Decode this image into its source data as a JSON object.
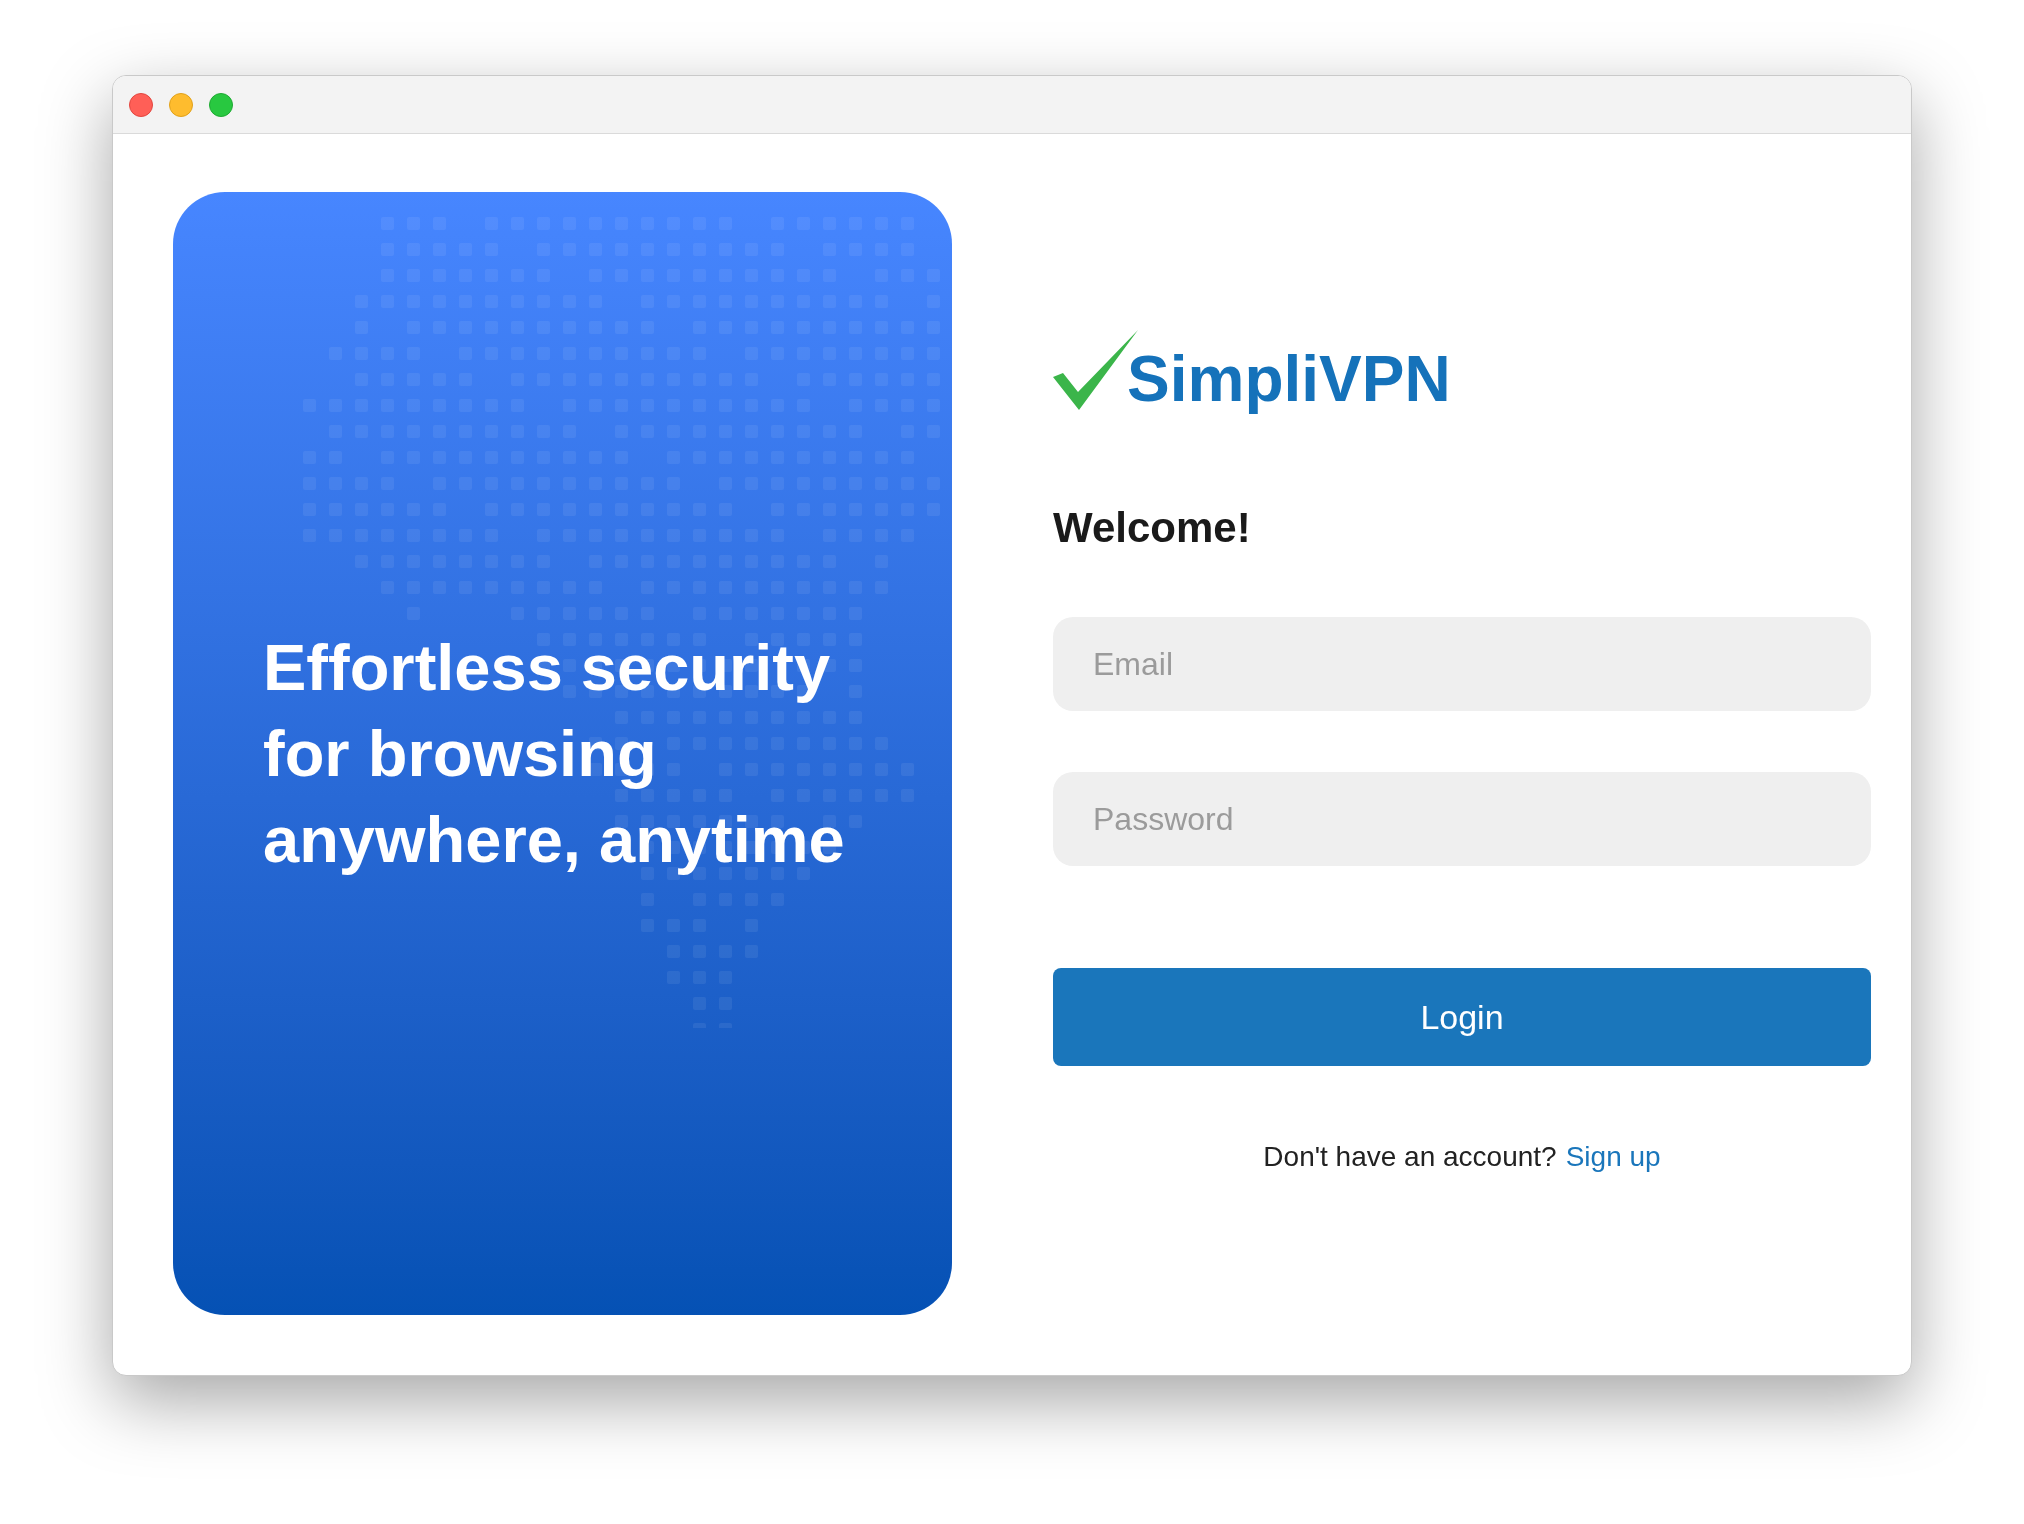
{
  "hero_panel": {
    "tagline": "Effortless security for browsing anywhere, anytime"
  },
  "login_form": {
    "logo_text": "SimpliVPN",
    "heading": "Welcome!",
    "fields": [
      {
        "placeholder": "Email"
      },
      {
        "placeholder": "Password"
      }
    ],
    "submit_button": "Login",
    "signup_prompt": {
      "text": "Don't have an account?",
      "link": "Sign up"
    }
  }
}
